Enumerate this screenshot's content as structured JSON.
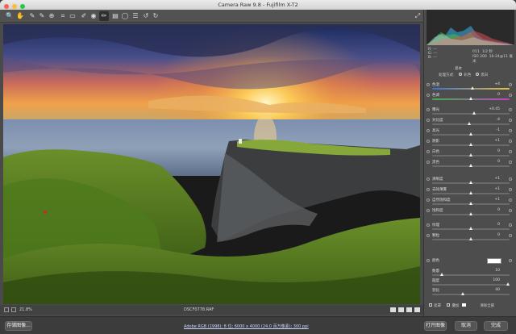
{
  "window": {
    "title": "Camera Raw 9.8 - Fujifilm X-T2"
  },
  "toolbar": {
    "tools": [
      "zoom-tool",
      "hand-tool",
      "white-balance-tool",
      "color-sampler-tool",
      "targeted-adjust-tool",
      "crop-tool",
      "straighten-tool",
      "spot-removal-tool",
      "red-eye-tool",
      "adjustment-brush-tool",
      "graduated-filter-tool",
      "radial-filter-tool",
      "open-prefs-tool",
      "rotate-ccw-tool",
      "rotate-cw-tool"
    ],
    "right_icon": "fullscreen-icon"
  },
  "histogram": {
    "r_label": "R:",
    "g_label": "G:",
    "b_label": "B:",
    "dash": "---",
    "aperture": "f/11",
    "shutter": "1/2 秒",
    "iso": "ISO 200",
    "lens": "16-24@11 毫米"
  },
  "panel": {
    "section_title": "基本",
    "mode_color": "彩色",
    "mode_bw": "黑白",
    "mode_label": "处理方式:"
  },
  "sliders": [
    {
      "label": "色温",
      "value": "+4",
      "pos": 0.53,
      "grad": "linear-gradient(90deg,#3b6fd6,#e7c23c)"
    },
    {
      "label": "色调",
      "value": "0",
      "pos": 0.5,
      "grad": "linear-gradient(90deg,#3fb04c,#c53fc1)"
    },
    {
      "label": "曝光",
      "value": "+0.45",
      "pos": 0.55,
      "grad": ""
    },
    {
      "label": "对比度",
      "value": "-4",
      "pos": 0.48,
      "grad": ""
    },
    {
      "label": "高光",
      "value": "-1",
      "pos": 0.5,
      "grad": ""
    },
    {
      "label": "阴影",
      "value": "+1",
      "pos": 0.5,
      "grad": ""
    },
    {
      "label": "白色",
      "value": "0",
      "pos": 0.5,
      "grad": ""
    },
    {
      "label": "黑色",
      "value": "0",
      "pos": 0.5,
      "grad": ""
    },
    {
      "label": "清晰度",
      "value": "+1",
      "pos": 0.5,
      "grad": ""
    },
    {
      "label": "去除薄雾",
      "value": "+1",
      "pos": 0.5,
      "grad": ""
    },
    {
      "label": "自然饱和度",
      "value": "+1",
      "pos": 0.5,
      "grad": ""
    },
    {
      "label": "饱和度",
      "value": "0",
      "pos": 0.5,
      "grad": ""
    },
    {
      "label": "纹理",
      "value": "0",
      "pos": 0.5,
      "grad": ""
    },
    {
      "label": "颗粒",
      "value": "0",
      "pos": 0.5,
      "grad": ""
    },
    {
      "label": "暗角",
      "value": "0",
      "pos": 0.5,
      "grad": ""
    },
    {
      "label": "羽化",
      "value": "0",
      "pos": 0.5,
      "grad": ""
    }
  ],
  "lower": {
    "label_a": "颜色",
    "label_b": "数量",
    "value_b": "10",
    "label_c": "圆度",
    "value_c": "100",
    "label_d": "羽化",
    "value_d": "40",
    "check_a": "遮罩",
    "check_b": "叠加",
    "clear_all": "清除全部"
  },
  "status": {
    "zoom": "21.8%",
    "filename": "DSCF0778.RAF"
  },
  "footer": {
    "save_label": "存储图像...",
    "info_link": "Adobe RGB (1998); 8 位; 6000 x 4000 (24.0 百万像素); 300 ppi",
    "open_label": "打开图像",
    "cancel_label": "取消",
    "done_label": "完成"
  },
  "colors": {
    "accent": "#2a7bd4",
    "panel_bg": "#4d4d4d"
  }
}
